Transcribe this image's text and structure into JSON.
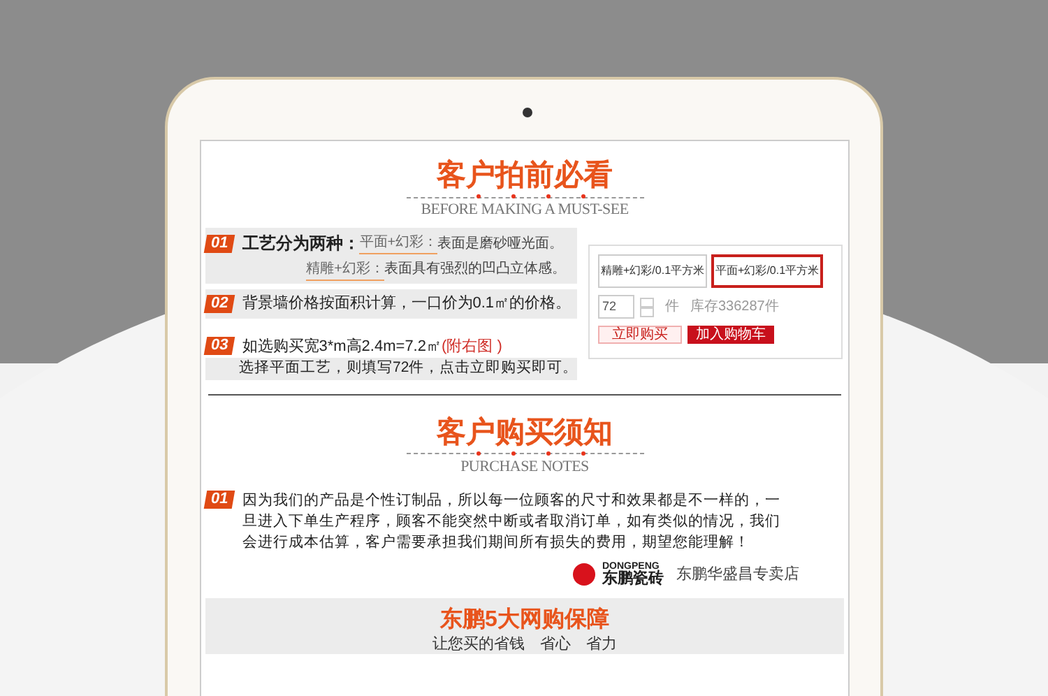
{
  "must_see": {
    "title": "客户拍前必看",
    "subtitle": "BEFORE MAKING A MUST-SEE",
    "items": [
      {
        "kind": "options",
        "number": "01",
        "heading": "工艺分为两种：",
        "options": [
          {
            "name": "平面+幻彩：",
            "desc": "表面是磨砂哑光面。"
          },
          {
            "name": "精雕+幻彩：",
            "desc": "表面具有强烈的凹凸立体感。"
          }
        ]
      },
      {
        "kind": "text",
        "number": "02",
        "text": "背景墙价格按面积计算，一口价为0.1㎡的价格。"
      },
      {
        "kind": "example",
        "number": "03",
        "text": "如选购买宽3*m高2.4m=7.2㎡",
        "note": "(附右图 )",
        "line2": "选择平面工艺，则填写72件，点击立即购买即可。"
      }
    ],
    "panel": {
      "variants": [
        {
          "label": "精雕+幻彩/0.1平方米",
          "selected": false
        },
        {
          "label": "平面+幻彩/0.1平方米",
          "selected": true
        }
      ],
      "quantity": "72",
      "unit": "件",
      "stock": "库存336287件",
      "buy_button": "立即购买",
      "cart_button": "加入购物车"
    }
  },
  "purchase_notes": {
    "title": "客户购买须知",
    "subtitle": "PURCHASE NOTES",
    "items": [
      {
        "number": "01",
        "text": "因为我们的产品是个性订制品，所以每一位顾客的尺寸和效果都是不一样的，一旦进入下单生产程序，顾客不能突然中断或者取消订单，如有类似的情况，我们会进行成本估算，客户需要承担我们期间所有损失的费用，期望您能理解！"
      }
    ],
    "brand_en": "DONGPENG",
    "brand_cn": "东鹏瓷砖",
    "store_name": "东鹏华盛昌专卖店"
  },
  "guarantee": {
    "title": "东鹏5大网购保障",
    "subtitle": "让您买的省钱　省心　省力"
  }
}
